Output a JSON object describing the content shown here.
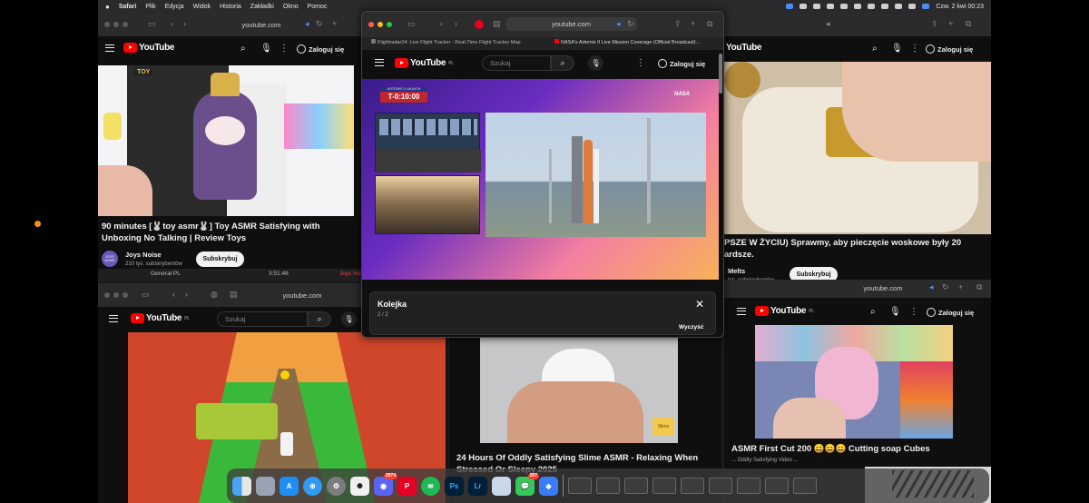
{
  "menubar": {
    "items": [
      "Safari",
      "Plik",
      "Edycja",
      "Widok",
      "Historia",
      "Zakładki",
      "Okno",
      "Pomoc"
    ],
    "clock": "Czw. 2 kwi 00:23"
  },
  "windows": {
    "top_left": {
      "url": "youtube.com",
      "login": "Zaloguj się",
      "logo": "YouTube",
      "video_title": "90 minutes [🐰toy asmr🐰] Toy ASMR Satisfying with Unboxing No Talking | Review Toys",
      "channel": "Joys Noise",
      "channel_avatar": "JOYS NOISE",
      "subscribers": "210 tys. subskrybentów",
      "subscribe": "Subskrybuj",
      "thumb_label": "TOY",
      "strip_channel": "Generał PL",
      "strip_time": "3:51:48",
      "strip_other": "Joys No"
    },
    "center": {
      "url": "youtube.com",
      "tabs": [
        "Flightradar24: Live Flight Tracker - Real-Time Flight Tracker Map",
        "NASA's Artemis II Live Mission Coverage (Official Broadcast)..."
      ],
      "logo": "YouTube",
      "logo_region": "PL",
      "search_placeholder": "Szukaj",
      "login": "Zaloguj się",
      "countdown_label": "ARTEMIS II LAUNCH",
      "countdown": "T-0:10:00",
      "nasa": "NASA",
      "queue_title": "Kolejka",
      "queue_count": "2 / 2",
      "queue_clear": "Wyczyść"
    },
    "top_right": {
      "url": "youtube.com",
      "login": "Zaloguj się",
      "logo": "YouTube",
      "video_title": "PSZE W ŻYCIU) Sprawmy, aby pieczęcie woskowe były 20 ardsze.",
      "channel": "Melts",
      "subscribers": "tys. subskrybentów",
      "subscribe": "Subskrybuj"
    },
    "bottom_left": {
      "url": "youtube.com",
      "logo": "YouTube",
      "logo_region": "PL",
      "search_placeholder": "Szukaj"
    },
    "bottom_middle": {
      "video_title": "24 Hours Of Oddly Satisfying Slime ASMR - Relaxing When Stressed Or Sleepy 2025",
      "badge": "Slime"
    },
    "bottom_right": {
      "url": "youtube.com",
      "login": "Zaloguj się",
      "logo": "YouTube",
      "logo_region": "PL",
      "video_title": "ASMR First Cut 200 😄😄😄 Cutting soap Cubes",
      "video_subtitle": "... Oddly Satisfying Video ..."
    }
  },
  "dock": {
    "apps": [
      "finder-icon",
      "launchpad-icon",
      "app-store-icon",
      "safari-icon",
      "settings-icon",
      "chatgpt-icon",
      "discord-icon",
      "pinterest-icon",
      "spotify-icon",
      "photoshop-icon",
      "lightroom-icon",
      "preview-icon",
      "messages-icon",
      "roblox-icon"
    ],
    "discord_badge": "2974",
    "messages_badge": "397",
    "ps_label": "Ps",
    "lr_label": "Lr"
  },
  "colors": {
    "yt_red": "#ff0000",
    "bg": "#0f0f0f",
    "accent_orange": "#f39019"
  }
}
